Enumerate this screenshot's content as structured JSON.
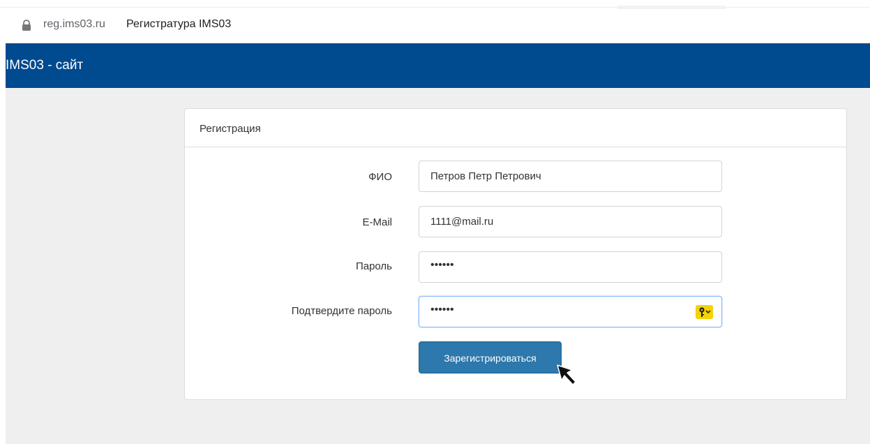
{
  "browser": {
    "url_domain": "reg.ims03.ru",
    "page_title": "Регистратура IMS03"
  },
  "navbar": {
    "brand": "IMS03 - сайт",
    "color": "#004a8f"
  },
  "form": {
    "title": "Регистрация",
    "fields": [
      {
        "label": "ФИО",
        "value": "Петров Петр Петрович",
        "type": "text"
      },
      {
        "label": "E-Mail",
        "value": "1111@mail.ru",
        "type": "email"
      },
      {
        "label": "Пароль",
        "value": "••••••",
        "type": "password"
      },
      {
        "label": "Подтвердите пароль",
        "value": "••••••",
        "type": "password",
        "focused": true,
        "icon": "key-icon"
      }
    ],
    "submit_label": "Зарегистрироваться",
    "submit_color": "#2d78ac"
  },
  "icons": {
    "address_bar": "lock-icon",
    "password_manager": "key-icon",
    "pointer": "mouse-cursor-icon"
  }
}
